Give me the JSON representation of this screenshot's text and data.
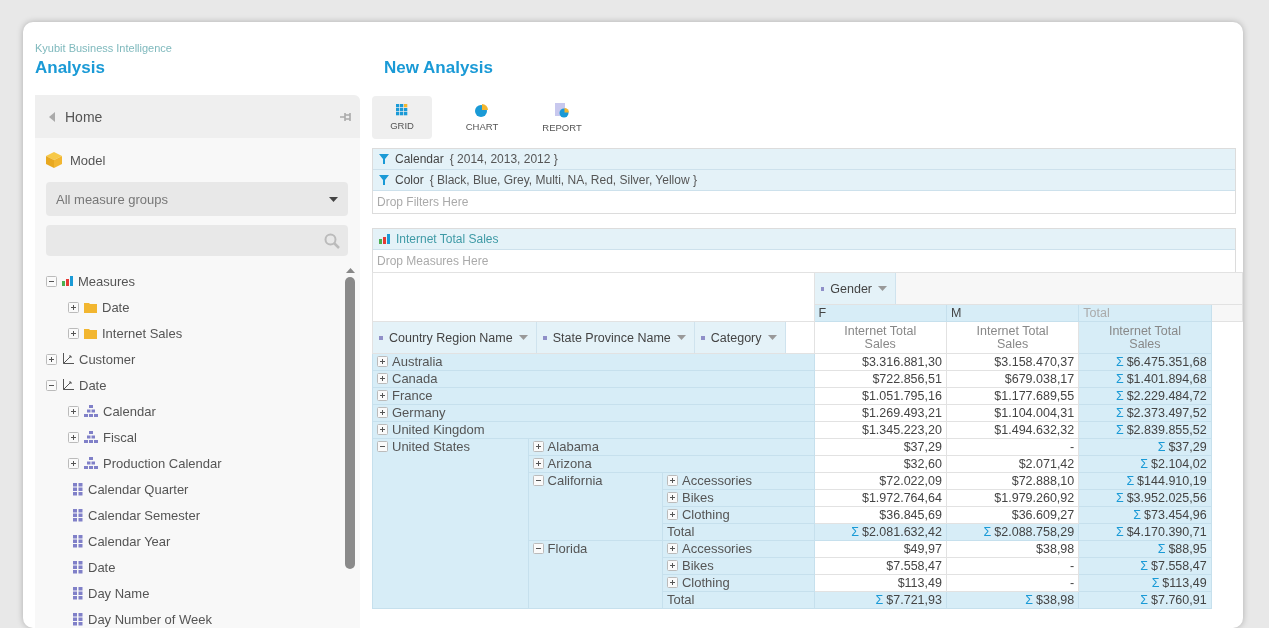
{
  "brand": {
    "product": "Kyubit Business Intelligence",
    "section": "Analysis"
  },
  "sidebar": {
    "home": "Home",
    "model": "Model",
    "measure_group_select": "All measure groups",
    "tree": [
      {
        "label": "Measures",
        "kind": "measures",
        "expanded": true,
        "children": [
          {
            "label": "Date",
            "kind": "folder",
            "expanded": false
          },
          {
            "label": "Internet Sales",
            "kind": "folder",
            "expanded": false
          }
        ]
      },
      {
        "label": "Customer",
        "kind": "dimension",
        "expanded": false
      },
      {
        "label": "Date",
        "kind": "dimension",
        "expanded": true,
        "children": [
          {
            "label": "Calendar",
            "kind": "hierarchy",
            "expanded": false
          },
          {
            "label": "Fiscal",
            "kind": "hierarchy",
            "expanded": false
          },
          {
            "label": "Production Calendar",
            "kind": "hierarchy",
            "expanded": false
          },
          {
            "label": "Calendar Quarter",
            "kind": "attribute"
          },
          {
            "label": "Calendar Semester",
            "kind": "attribute"
          },
          {
            "label": "Calendar Year",
            "kind": "attribute"
          },
          {
            "label": "Date",
            "kind": "attribute"
          },
          {
            "label": "Day Name",
            "kind": "attribute"
          },
          {
            "label": "Day Number of Week",
            "kind": "attribute"
          }
        ]
      }
    ]
  },
  "analysis": {
    "title": "New Analysis",
    "views": [
      {
        "label": "GRID",
        "kind": "grid",
        "selected": true
      },
      {
        "label": "CHART",
        "kind": "chart",
        "selected": false
      },
      {
        "label": "REPORT",
        "kind": "report",
        "selected": false
      }
    ],
    "filters": [
      {
        "field": "Calendar",
        "members": "{ 2014, 2013, 2012 }"
      },
      {
        "field": "Color",
        "members": "{ Black, Blue, Grey, Multi, NA, Red, Silver, Yellow }"
      }
    ],
    "filters_drop": "Drop Filters Here",
    "measures": [
      "Internet Total Sales"
    ],
    "measures_drop": "Drop Measures Here",
    "pivot": {
      "column_field": "Gender",
      "column_members": [
        {
          "label": "F",
          "kind": "member"
        },
        {
          "label": "M",
          "kind": "member"
        },
        {
          "label": "Total",
          "kind": "total"
        }
      ],
      "measure_headers": [
        "Internet Total Sales",
        "Internet Total Sales",
        "Internet Total Sales"
      ],
      "row_fields": [
        "Country Region Name",
        "State Province Name",
        "Category"
      ],
      "rows": [
        {
          "label": "Australia",
          "expanded": false,
          "values": [
            {
              "text": "$3.316.881,30"
            },
            {
              "text": "$3.158.470,37"
            },
            {
              "sigma": "Σ",
              "text": "$6.475.351,68"
            }
          ]
        },
        {
          "label": "Canada",
          "expanded": false,
          "values": [
            {
              "text": "$722.856,51"
            },
            {
              "text": "$679.038,17"
            },
            {
              "sigma": "Σ",
              "text": "$1.401.894,68"
            }
          ]
        },
        {
          "label": "France",
          "expanded": false,
          "values": [
            {
              "text": "$1.051.795,16"
            },
            {
              "text": "$1.177.689,55"
            },
            {
              "sigma": "Σ",
              "text": "$2.229.484,72"
            }
          ]
        },
        {
          "label": "Germany",
          "expanded": false,
          "values": [
            {
              "text": "$1.269.493,21"
            },
            {
              "text": "$1.104.004,31"
            },
            {
              "sigma": "Σ",
              "text": "$2.373.497,52"
            }
          ]
        },
        {
          "label": "United Kingdom",
          "expanded": false,
          "values": [
            {
              "text": "$1.345.223,20"
            },
            {
              "text": "$1.494.632,32"
            },
            {
              "sigma": "Σ",
              "text": "$2.839.855,52"
            }
          ]
        },
        {
          "label": "United States",
          "expanded": true,
          "children": [
            {
              "label": "Alabama",
              "expanded": false,
              "values": [
                {
                  "text": "$37,29"
                },
                {
                  "text": "-"
                },
                {
                  "sigma": "Σ",
                  "text": "$37,29"
                }
              ]
            },
            {
              "label": "Arizona",
              "expanded": false,
              "values": [
                {
                  "text": "$32,60"
                },
                {
                  "text": "$2.071,42"
                },
                {
                  "sigma": "Σ",
                  "text": "$2.104,02"
                }
              ]
            },
            {
              "label": "California",
              "expanded": true,
              "children": [
                {
                  "label": "Accessories",
                  "expanded": false,
                  "values": [
                    {
                      "text": "$72.022,09"
                    },
                    {
                      "text": "$72.888,10"
                    },
                    {
                      "sigma": "Σ",
                      "text": "$144.910,19"
                    }
                  ]
                },
                {
                  "label": "Bikes",
                  "expanded": false,
                  "values": [
                    {
                      "text": "$1.972.764,64"
                    },
                    {
                      "text": "$1.979.260,92"
                    },
                    {
                      "sigma": "Σ",
                      "text": "$3.952.025,56"
                    }
                  ]
                },
                {
                  "label": "Clothing",
                  "expanded": false,
                  "values": [
                    {
                      "text": "$36.845,69"
                    },
                    {
                      "text": "$36.609,27"
                    },
                    {
                      "sigma": "Σ",
                      "text": "$73.454,96"
                    }
                  ]
                },
                {
                  "label": "Total",
                  "kind": "total",
                  "values": [
                    {
                      "sigma": "Σ",
                      "text": "$2.081.632,42"
                    },
                    {
                      "sigma": "Σ",
                      "text": "$2.088.758,29"
                    },
                    {
                      "sigma": "Σ",
                      "text": "$4.170.390,71"
                    }
                  ]
                }
              ]
            },
            {
              "label": "Florida",
              "expanded": true,
              "children": [
                {
                  "label": "Accessories",
                  "expanded": false,
                  "values": [
                    {
                      "text": "$49,97"
                    },
                    {
                      "text": "$38,98"
                    },
                    {
                      "sigma": "Σ",
                      "text": "$88,95"
                    }
                  ]
                },
                {
                  "label": "Bikes",
                  "expanded": false,
                  "values": [
                    {
                      "text": "$7.558,47"
                    },
                    {
                      "text": "-"
                    },
                    {
                      "sigma": "Σ",
                      "text": "$7.558,47"
                    }
                  ]
                },
                {
                  "label": "Clothing",
                  "expanded": false,
                  "values": [
                    {
                      "text": "$113,49"
                    },
                    {
                      "text": "-"
                    },
                    {
                      "sigma": "Σ",
                      "text": "$113,49"
                    }
                  ]
                },
                {
                  "label": "Total",
                  "kind": "total",
                  "values": [
                    {
                      "sigma": "Σ",
                      "text": "$7.721,93"
                    },
                    {
                      "sigma": "Σ",
                      "text": "$38,98"
                    },
                    {
                      "sigma": "Σ",
                      "text": "$7.760,91"
                    }
                  ]
                }
              ]
            }
          ]
        }
      ]
    }
  }
}
